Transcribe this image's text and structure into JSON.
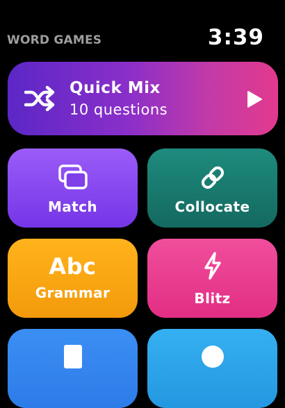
{
  "header": {
    "app_title": "WORD GAMES",
    "time": "3:39"
  },
  "quick_mix": {
    "title": "Quick Mix",
    "subtitle": "10 questions",
    "icon": "shuffle-icon",
    "action_icon": "play-icon"
  },
  "tiles": [
    {
      "label": "Match",
      "icon": "cards-icon",
      "color": "#8448f0"
    },
    {
      "label": "Collocate",
      "icon": "link-icon",
      "color": "#177a6f"
    },
    {
      "label": "Grammar",
      "icon_text": "Abc",
      "color": "#f7a614"
    },
    {
      "label": "Blitz",
      "icon": "lightning-icon",
      "color": "#e83d8f"
    },
    {
      "label": "",
      "icon": "document-icon",
      "color": "#3486ee"
    },
    {
      "label": "",
      "icon": "circle-icon",
      "color": "#2ca3ea"
    }
  ]
}
